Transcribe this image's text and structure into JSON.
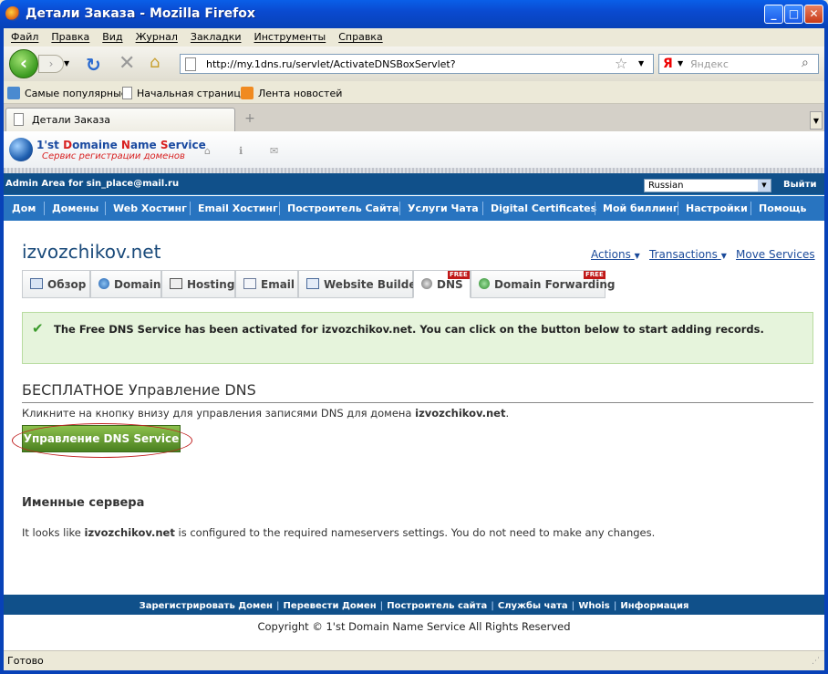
{
  "window": {
    "title": "Детали Заказа - Mozilla Firefox",
    "min": "_",
    "max": "□",
    "close": "✕"
  },
  "menu": [
    "Файл",
    "Правка",
    "Вид",
    "Журнал",
    "Закладки",
    "Инструменты",
    "Справка"
  ],
  "nav": {
    "url": "http://my.1dns.ru/servlet/ActivateDNSBoxServlet?",
    "search_engine": "Я",
    "search_placeholder": "Яндекс"
  },
  "bookmarks": [
    "Самые популярные",
    "Начальная страница",
    "Лента новостей"
  ],
  "tabs": {
    "active": "Детали Заказа",
    "new_tab": "+"
  },
  "site": {
    "logo_title_a": "1'st ",
    "logo_title_b": "D",
    "logo_title_c": "omaine ",
    "logo_title_d": "N",
    "logo_title_e": "ame ",
    "logo_title_f": "S",
    "logo_title_g": "ervice",
    "logo_subtitle": "Сервис регистрации доменов",
    "admin_label": "Admin Area for sin_place@mail.ru",
    "language": "Russian",
    "logout": "Выйти",
    "main_nav": [
      "Дом",
      "Домены",
      "Web Хостинг",
      "Email Хостинг",
      "Построитель Сайта",
      "Услуги Чата",
      "Digital Certificates",
      "Мой биллинг",
      "Настройки",
      "Помощь"
    ]
  },
  "domain": {
    "name": "izvozchikov.net"
  },
  "top_links": [
    "Actions",
    "Transactions",
    "Move Services"
  ],
  "service_tabs": [
    {
      "label": "Обзор"
    },
    {
      "label": "Domain"
    },
    {
      "label": "Hosting"
    },
    {
      "label": "Email"
    },
    {
      "label": "Website Builder"
    },
    {
      "label": "DNS",
      "badge": "FREE"
    },
    {
      "label": "Domain Forwarding",
      "badge": "FREE"
    }
  ],
  "notice": "The Free DNS Service has been activated for izvozchikov.net. You can click on the button below to start adding records.",
  "dns": {
    "heading": "БЕСПЛАТНОЕ Управление DNS",
    "desc_prefix": "Кликните на кнопку внизу для управления записями DNS для домена ",
    "desc_domain": "izvozchikov.net",
    "desc_suffix": ".",
    "button": "Управление DNS Service"
  },
  "nameservers": {
    "heading": "Именные сервера",
    "desc_prefix": "It looks like ",
    "desc_domain": "izvozchikov.net",
    "desc_suffix": " is configured to the required nameservers settings. You do not need to make any changes."
  },
  "footer_links": [
    "Зарегистрировать Домен",
    "Перевести Домен",
    "Построитель сайта",
    "Службы чата",
    "Whois",
    "Информация"
  ],
  "copyright": "Copyright © 1'st Domain Name Service All Rights Reserved",
  "status": "Готово"
}
